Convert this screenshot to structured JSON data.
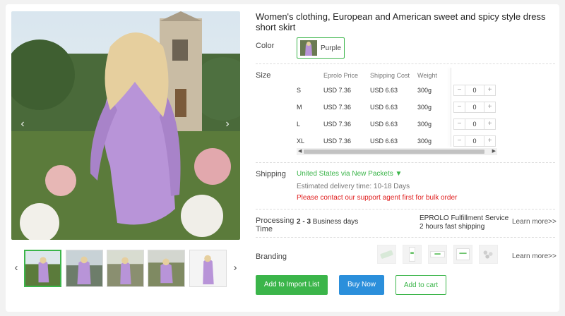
{
  "product": {
    "title": "Women's clothing, European and American sweet and spicy style dress short skirt"
  },
  "gallery": {
    "prev_arrow": "‹",
    "next_arrow": "›",
    "thumb_prev": "‹",
    "thumb_next": "›",
    "thumbnail_count": 5,
    "active_thumbnail": 1
  },
  "color": {
    "label": "Color",
    "options": [
      {
        "name": "Purple",
        "selected": true
      }
    ]
  },
  "size": {
    "label": "Size",
    "headers": [
      "Eprolo Price",
      "Shipping Cost",
      "Weight"
    ],
    "rows": [
      {
        "size": "S",
        "price": "USD 7.36",
        "shipping": "USD 6.63",
        "weight": "300g",
        "qty": "0"
      },
      {
        "size": "M",
        "price": "USD 7.36",
        "shipping": "USD 6.63",
        "weight": "300g",
        "qty": "0"
      },
      {
        "size": "L",
        "price": "USD 7.36",
        "shipping": "USD 6.63",
        "weight": "300g",
        "qty": "0"
      },
      {
        "size": "XL",
        "price": "USD 7.36",
        "shipping": "USD 6.63",
        "weight": "300g",
        "qty": "0"
      }
    ],
    "minus": "−",
    "plus": "+"
  },
  "shipping": {
    "label": "Shipping",
    "method": "United States via New Packets ▼",
    "estimate": "Estimated delivery time: 10-18 Days",
    "warning": "Please contact our support agent first for bulk order"
  },
  "processing": {
    "label_line1": "Processing",
    "label_line2": "Time",
    "days_bold": "2 - 3",
    "days_rest": " Business days",
    "service_line1": "EPROLO Fulfillment Service",
    "service_line2": "2 hours fast shipping",
    "learn_more": "Learn more>>"
  },
  "branding": {
    "label": "Branding",
    "learn_more": "Learn more>>",
    "image_count": 5
  },
  "actions": {
    "import": "Add to Import List",
    "buy": "Buy Now",
    "cart": "Add to cart"
  },
  "colors": {
    "accent_green": "#3bb54a",
    "buy_blue": "#2b8fdb",
    "warning_red": "#e02020",
    "dress_purple": "#b894d8"
  }
}
